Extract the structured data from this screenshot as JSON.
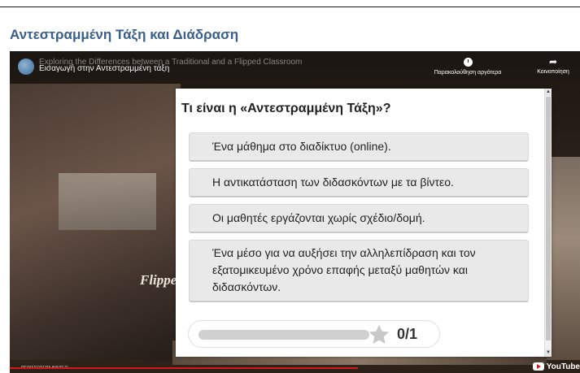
{
  "page": {
    "title": "Αντεστραμμένη Τάξη και Διάδραση"
  },
  "video": {
    "title_bg": "Exploring the Differences between a Traditional and a Flipped Classroom",
    "title": "Εισαγωγή στην Αντεστραμμένη τάξη",
    "watch_later": "Παρακολούθηση αργότερα",
    "share": "Κοινοποίηση",
    "frame_text": "Flippe",
    "more_videos": "ΠΕΡΙΣΣΟΤΕΡΑ ΒΙΝΤΕΟ",
    "logo": "YouTube",
    "played_fraction": 0.61
  },
  "quiz": {
    "question": "Τι είναι η «Αντεστραμμένη Τάξη»?",
    "answers": [
      "Ένα μάθημα στο διαδίκτυο (online).",
      "Η  αντικατάσταση των διδασκόντων με τα βίντεο.",
      "Οι μαθητές εργάζονται χωρίς σχέδιο/δομή.",
      "Ένα μέσο για να αυξήσει την αλληλεπίδραση και τον εξατομικευμένο χρόνο επαφής μεταξύ μαθητών και διδασκόντων."
    ],
    "score": "0/1",
    "score_value": 0,
    "score_max": 1
  },
  "colors": {
    "title": "#3a5f8a",
    "progress_red": "#d21a1a",
    "answer_bg": "#e9e9e9"
  }
}
